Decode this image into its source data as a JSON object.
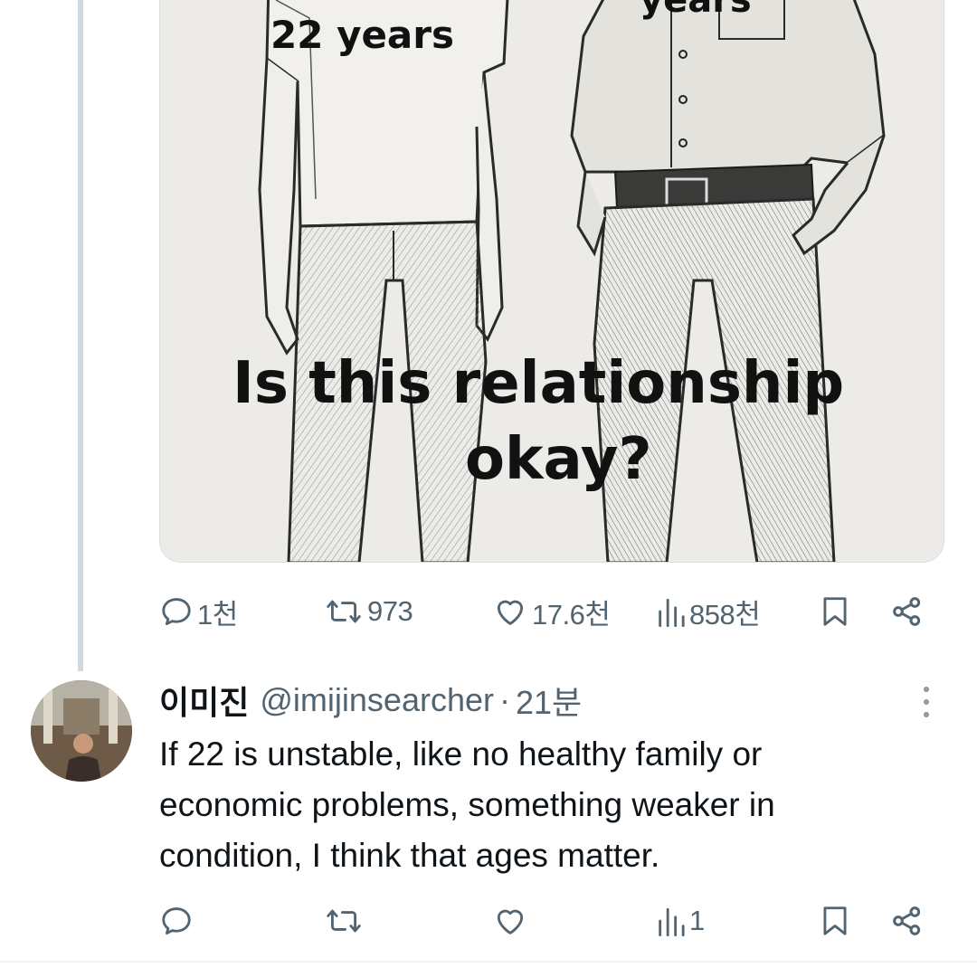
{
  "post": {
    "image": {
      "alt": "Sketch of a young woman and an older man standing side by side",
      "label_left": "22 years",
      "label_right": "years",
      "caption_line1": "Is this relationship",
      "caption_line2": "okay?"
    },
    "actions": {
      "reply_count": "1천",
      "repost_count": "973",
      "like_count": "17.6천",
      "view_count": "858천"
    }
  },
  "reply": {
    "display_name": "이미진",
    "handle": "@imijinsearcher",
    "separator": "·",
    "time": "21분",
    "text": "If 22 is unstable, like no healthy family or economic problems, something weaker in condition, I think that ages matter.",
    "actions": {
      "view_count": "1"
    }
  },
  "colors": {
    "muted": "#536471",
    "text": "#0f1419",
    "thread_line": "#cfd9de"
  },
  "icons": [
    "reply-icon",
    "repost-icon",
    "like-icon",
    "views-icon",
    "bookmark-icon",
    "share-icon",
    "more-icon"
  ]
}
